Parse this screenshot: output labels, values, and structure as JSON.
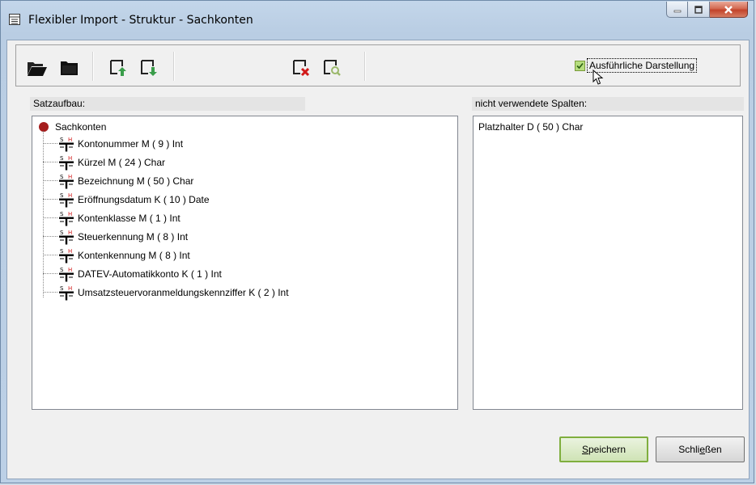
{
  "window": {
    "title": "Flexibler Import - Struktur - Sachkonten"
  },
  "toolbar": {
    "buttons": [
      {
        "name": "open-folder-button",
        "icon": "open-folder-icon"
      },
      {
        "name": "folder-button",
        "icon": "folder-icon"
      },
      {
        "name": "move-up-button",
        "icon": "arrow-up-icon"
      },
      {
        "name": "move-down-button",
        "icon": "arrow-down-icon"
      },
      {
        "name": "delete-button",
        "icon": "delete-icon"
      },
      {
        "name": "search-button",
        "icon": "magnify-icon"
      }
    ],
    "detail_checkbox": {
      "label": "Ausführliche Darstellung",
      "checked": true
    }
  },
  "left_panel": {
    "label": "Satzaufbau:",
    "root": "Sachkonten",
    "items": [
      "Kontonummer  M  ( 9 ) Int",
      "Kürzel  M  ( 24 ) Char",
      "Bezeichnung  M  ( 50 ) Char",
      "Eröffnungsdatum  K  ( 10 ) Date",
      "Kontenklasse  M  ( 1 ) Int",
      "Steuerkennung  M  ( 8 ) Int",
      "Kontenkennung  M  ( 8 ) Int",
      "DATEV-Automatikkonto  K  ( 1 ) Int",
      "Umsatzsteuervoranmeldungskennziffer  K  ( 2 ) Int"
    ]
  },
  "right_panel": {
    "label": "nicht verwendete Spalten:",
    "items": [
      "Platzhalter  D  ( 50 ) Char"
    ]
  },
  "buttons": {
    "save": {
      "pre": "",
      "ul": "S",
      "post": "peichern"
    },
    "close": {
      "pre": "Schli",
      "ul": "e",
      "post": "ßen"
    }
  },
  "colors": {
    "accent_green": "#7fae3e",
    "root_red": "#a51d1d",
    "delete_red": "#d11a1a"
  }
}
